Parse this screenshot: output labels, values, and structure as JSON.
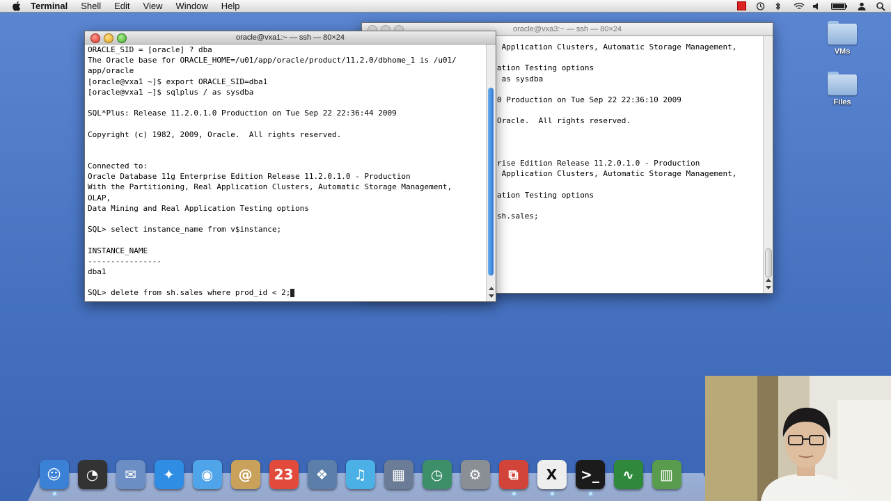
{
  "menubar": {
    "app_name": "Terminal",
    "items": [
      "Shell",
      "Edit",
      "View",
      "Window",
      "Help"
    ]
  },
  "desktop": {
    "icons": [
      {
        "label": "VMs"
      },
      {
        "label": "Files"
      }
    ]
  },
  "front_window": {
    "title": "oracle@vxa1:~ — ssh — 80×24",
    "lines": [
      "ORACLE_SID = [oracle] ? dba",
      "The Oracle base for ORACLE_HOME=/u01/app/oracle/product/11.2.0/dbhome_1 is /u01/",
      "app/oracle",
      "[oracle@vxa1 ~]$ export ORACLE_SID=dba1",
      "[oracle@vxa1 ~]$ sqlplus / as sysdba",
      "",
      "SQL*Plus: Release 11.2.0.1.0 Production on Tue Sep 22 22:36:44 2009",
      "",
      "Copyright (c) 1982, 2009, Oracle.  All rights reserved.",
      "",
      "",
      "Connected to:",
      "Oracle Database 11g Enterprise Edition Release 11.2.0.1.0 - Production",
      "With the Partitioning, Real Application Clusters, Automatic Storage Management,",
      "OLAP,",
      "Data Mining and Real Application Testing options",
      "",
      "SQL> select instance_name from v$instance;",
      "",
      "INSTANCE_NAME",
      "----------------",
      "dba1",
      "",
      "SQL> delete from sh.sales where prod_id < 2;"
    ]
  },
  "back_window": {
    "title": "oracle@vxa3:~ — ssh — 80×24",
    "lines": [
      " Application Clusters, Automatic Storage Management,",
      "",
      "ation Testing options",
      " as sysdba",
      "",
      "0 Production on Tue Sep 22 22:36:10 2009",
      "",
      "Oracle.  All rights reserved.",
      "",
      "",
      "",
      "rise Edition Release 11.2.0.1.0 - Production",
      " Application Clusters, Automatic Storage Management,",
      "",
      "ation Testing options",
      "",
      "sh.sales;"
    ]
  },
  "dock": {
    "icons": [
      {
        "name": "finder-icon",
        "glyph": "☺",
        "color": "#3b82d6"
      },
      {
        "name": "dashboard-icon",
        "glyph": "◔",
        "color": "#333333"
      },
      {
        "name": "mail-icon",
        "glyph": "✉",
        "color": "#6b8fc4"
      },
      {
        "name": "safari-icon",
        "glyph": "✦",
        "color": "#2f8de4"
      },
      {
        "name": "ichat-icon",
        "glyph": "◉",
        "color": "#4fa4ea"
      },
      {
        "name": "address-book-icon",
        "glyph": "@",
        "color": "#c9a15a"
      },
      {
        "name": "ical-icon",
        "glyph": "23",
        "color": "#e24b3b"
      },
      {
        "name": "iphoto-icon",
        "glyph": "❖",
        "color": "#5b7fa8"
      },
      {
        "name": "itunes-icon",
        "glyph": "♫",
        "color": "#4ab0e6"
      },
      {
        "name": "spaces-icon",
        "glyph": "▦",
        "color": "#6b7d96"
      },
      {
        "name": "time-machine-icon",
        "glyph": "◷",
        "color": "#3d8f6a"
      },
      {
        "name": "system-preferences-icon",
        "glyph": "⚙",
        "color": "#8a8f96"
      },
      {
        "name": "vmware-icon",
        "glyph": "⧉",
        "color": "#d2443a"
      },
      {
        "name": "x11-icon",
        "glyph": "X",
        "color": "#eeeeee"
      },
      {
        "name": "terminal-icon",
        "glyph": ">_",
        "color": "#1b1b1b"
      },
      {
        "name": "activity-monitor-icon",
        "glyph": "∿",
        "color": "#2e8a3a"
      },
      {
        "name": "trash-icon",
        "glyph": "▥",
        "color": "#5a9c4e"
      }
    ]
  }
}
